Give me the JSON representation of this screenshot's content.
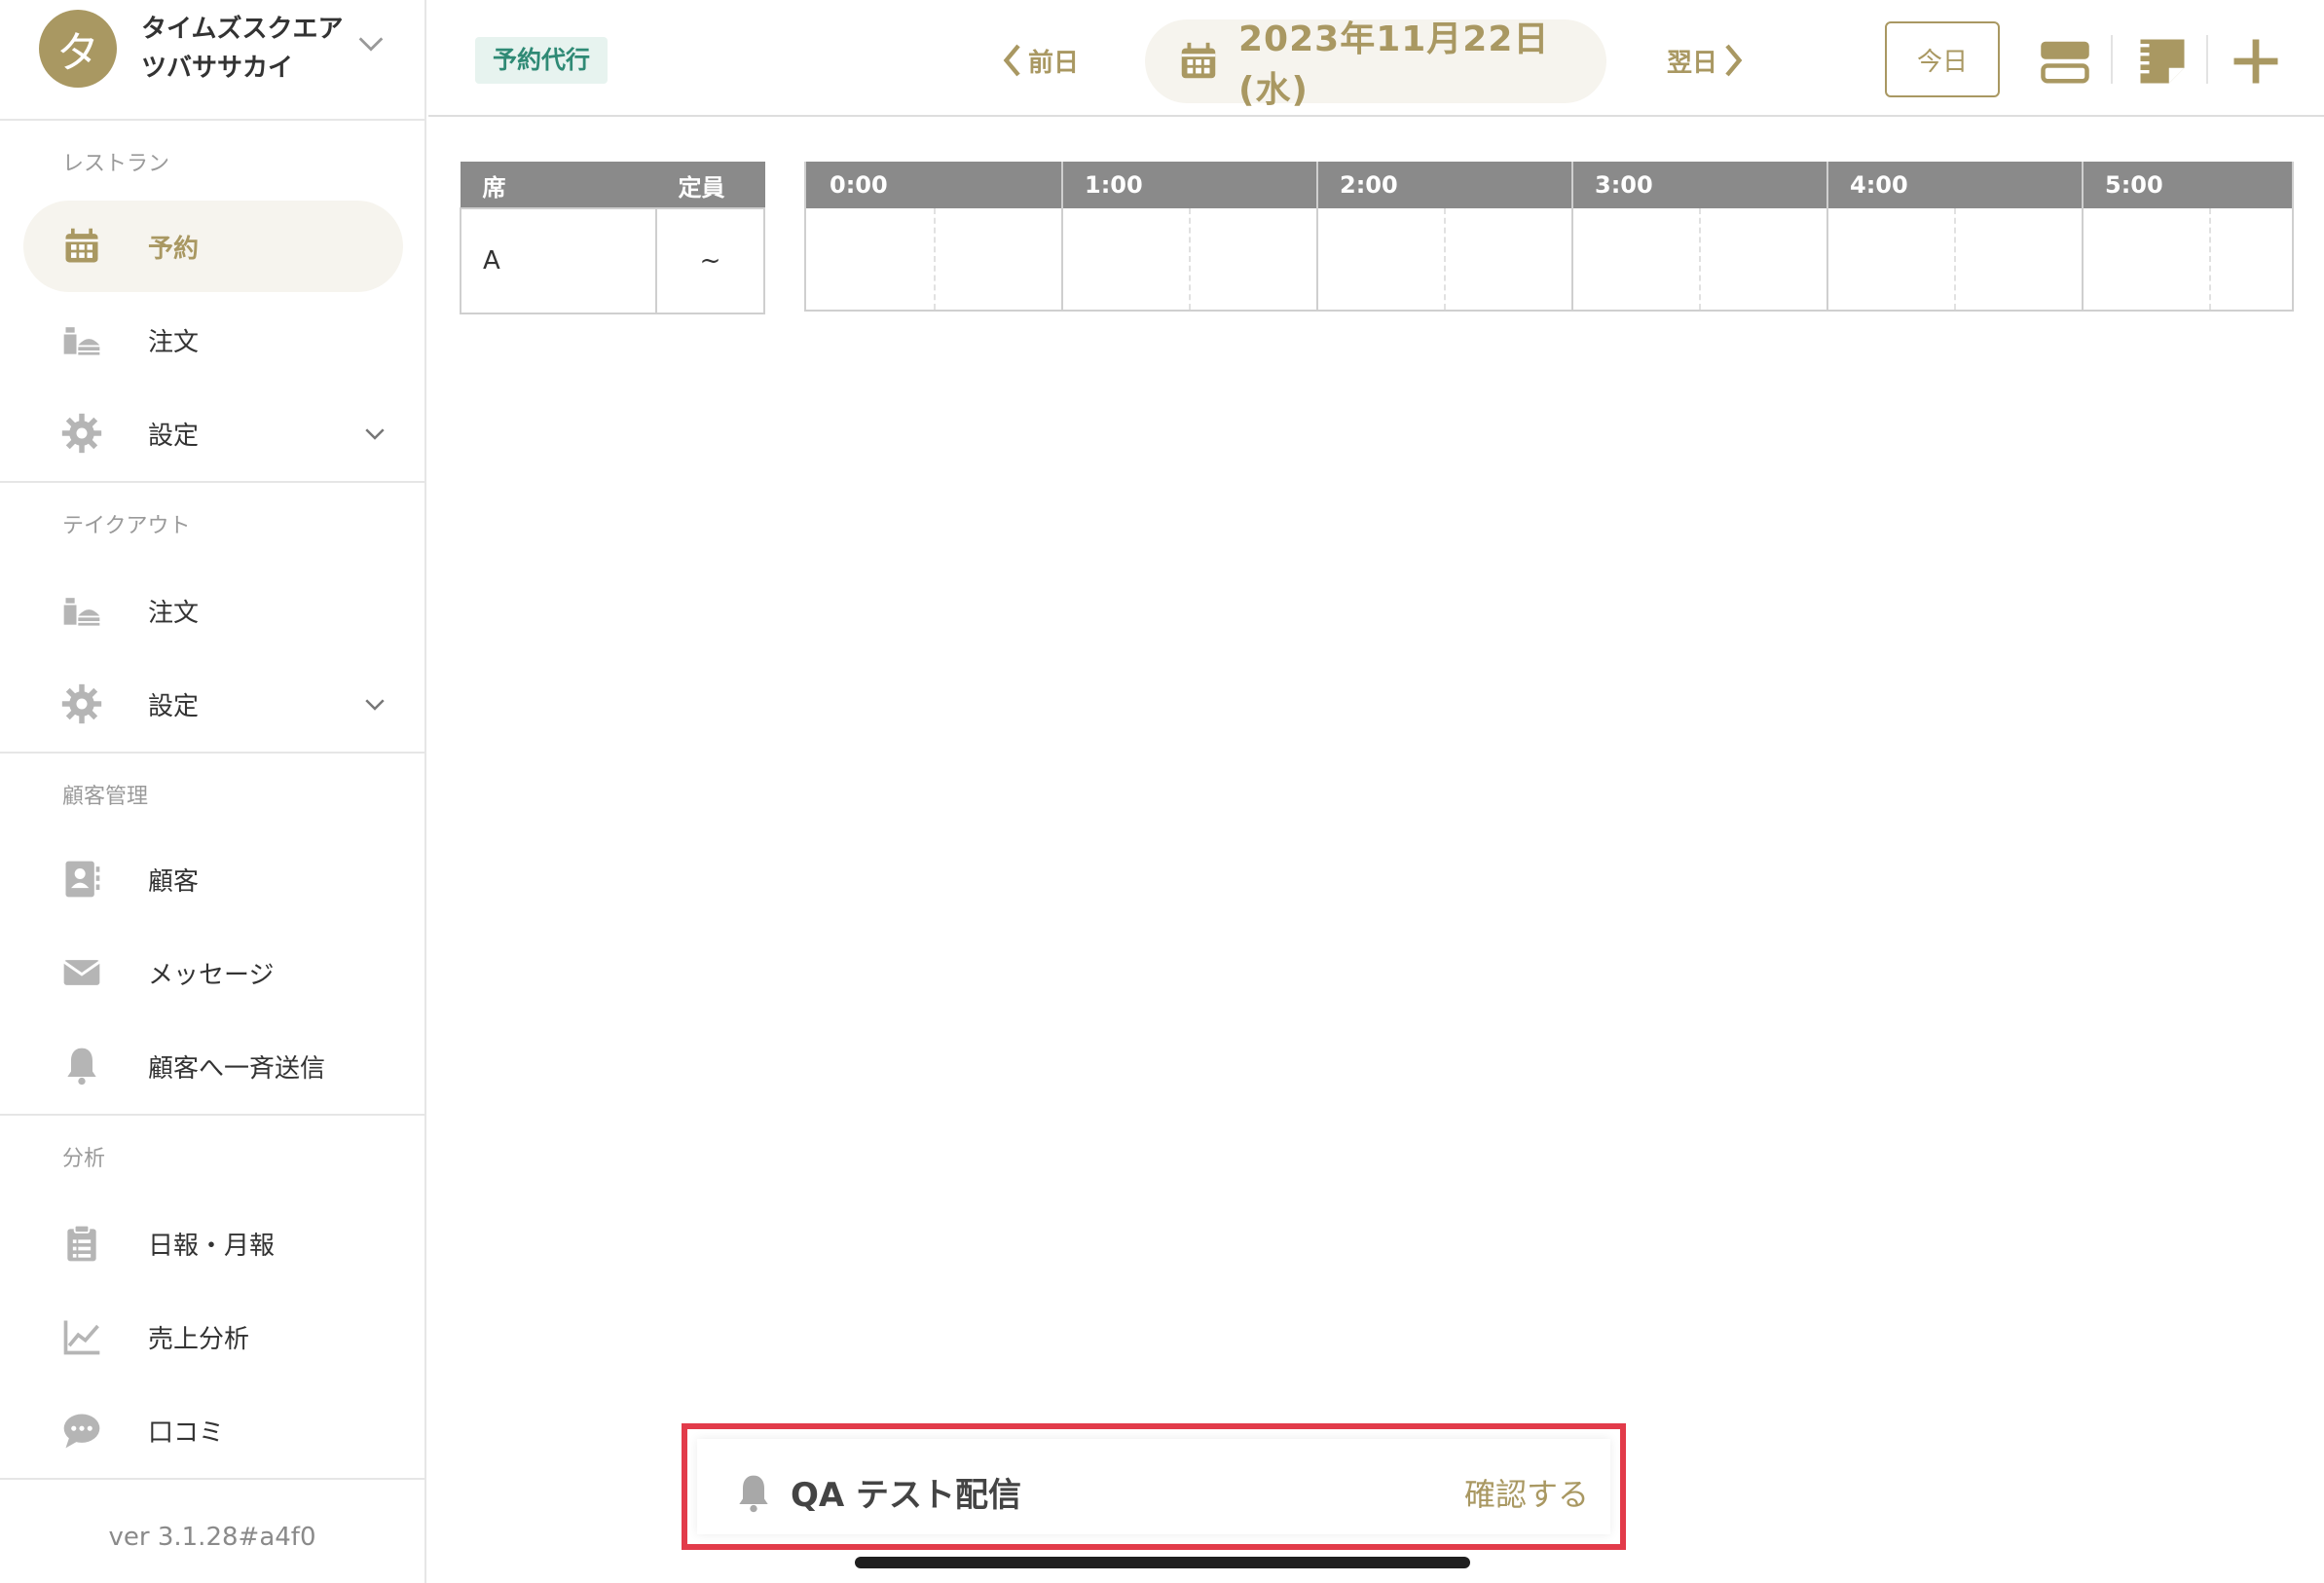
{
  "shop": {
    "avatar_initial": "タ",
    "name_line1": "タイムズスクエア",
    "name_line2": "ツバササカイ"
  },
  "sidebar": {
    "restaurant_label": "レストラン",
    "restaurant_items": [
      {
        "label": "予約",
        "icon": "calendar-icon",
        "active": true
      },
      {
        "label": "注文",
        "icon": "food-tray-icon"
      },
      {
        "label": "設定",
        "icon": "gear-icon",
        "expandable": true
      }
    ],
    "takeout_label": "テイクアウト",
    "takeout_items": [
      {
        "label": "注文",
        "icon": "food-tray-icon"
      },
      {
        "label": "設定",
        "icon": "gear-icon",
        "expandable": true
      }
    ],
    "customer_label": "顧客管理",
    "customer_items": [
      {
        "label": "顧客",
        "icon": "contact-book-icon"
      },
      {
        "label": "メッセージ",
        "icon": "envelope-icon"
      },
      {
        "label": "顧客へ一斉送信",
        "icon": "bell-icon"
      }
    ],
    "analysis_label": "分析",
    "analysis_items": [
      {
        "label": "日報・月報",
        "icon": "clipboard-icon"
      },
      {
        "label": "売上分析",
        "icon": "line-chart-icon"
      },
      {
        "label": "口コミ",
        "icon": "chat-bubble-icon"
      }
    ],
    "version": "ver 3.1.28#a4f0"
  },
  "topbar": {
    "proxy_badge": "予約代行",
    "prev_label": "前日",
    "date_label": "2023年11月22日 (水)",
    "next_label": "翌日",
    "today_label": "今日"
  },
  "seat_table": {
    "headers": [
      "席",
      "定員"
    ],
    "rows": [
      {
        "seat": "A",
        "capacity": "~"
      }
    ]
  },
  "timeline": {
    "hours": [
      "0:00",
      "1:00",
      "2:00",
      "3:00",
      "4:00",
      "5:00"
    ]
  },
  "notification": {
    "title": "QA テスト配信",
    "action": "確認する"
  },
  "colors": {
    "accent": "#a99862",
    "proxy_green": "#2f8a75",
    "highlight_border": "#e23b4a"
  }
}
